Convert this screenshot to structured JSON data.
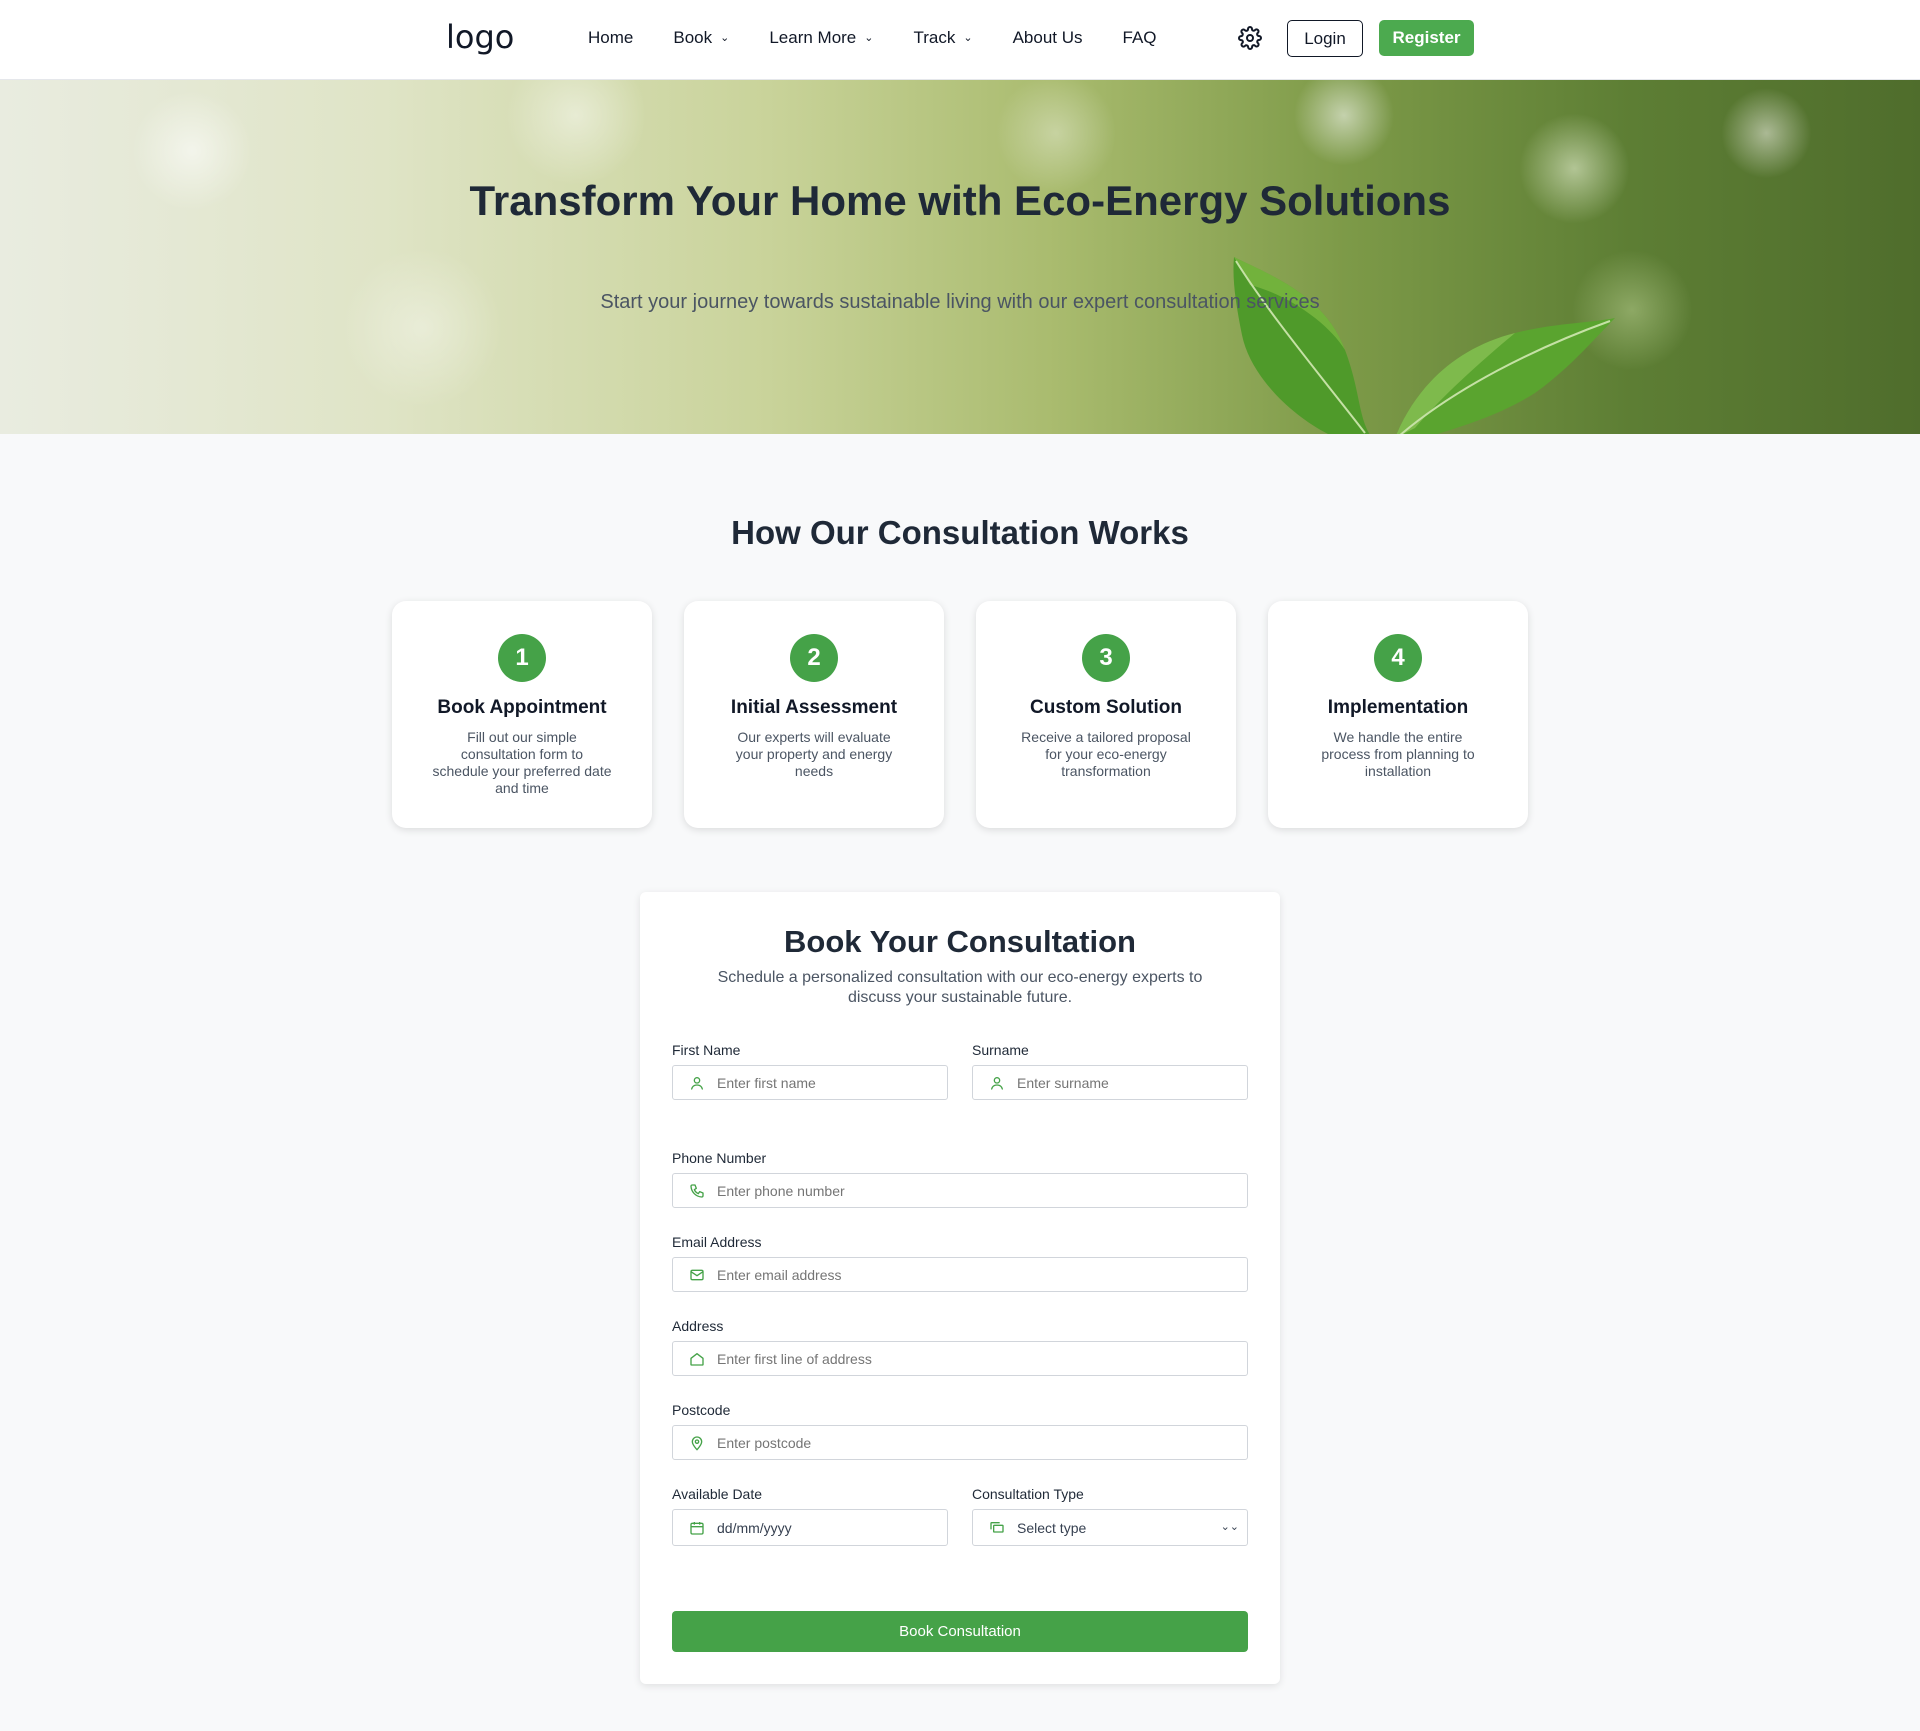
{
  "nav": {
    "logo": "logo",
    "links": [
      {
        "label": "Home",
        "dropdown": false
      },
      {
        "label": "Book",
        "dropdown": true
      },
      {
        "label": "Learn More",
        "dropdown": true
      },
      {
        "label": "Track",
        "dropdown": true
      },
      {
        "label": "About Us",
        "dropdown": false
      },
      {
        "label": "FAQ",
        "dropdown": false
      }
    ],
    "settings_icon": "gear-icon",
    "login_label": "Login",
    "register_label": "Register"
  },
  "hero": {
    "title": "Transform Your Home with Eco-Energy Solutions",
    "subtitle": "Start your journey towards sustainable living with our expert consultation services"
  },
  "how": {
    "title": "How Our Consultation Works",
    "steps": [
      {
        "number": "1",
        "title": "Book Appointment",
        "description": "Fill out our simple consultation form to schedule your preferred date and time"
      },
      {
        "number": "2",
        "title": "Initial Assessment",
        "description": "Our experts will evaluate your property and energy needs"
      },
      {
        "number": "3",
        "title": "Custom Solution",
        "description": "Receive a tailored proposal for your eco-energy transformation"
      },
      {
        "number": "4",
        "title": "Implementation",
        "description": "We handle the entire process from planning to installation"
      }
    ]
  },
  "form": {
    "title": "Book Your Consultation",
    "subtitle": "Schedule a personalized consultation with our eco-energy experts to discuss your sustainable future.",
    "first_name": {
      "label": "First Name",
      "placeholder": "Enter first name",
      "icon": "user-icon"
    },
    "surname": {
      "label": "Surname",
      "placeholder": "Enter surname",
      "icon": "user-icon"
    },
    "phone": {
      "label": "Phone Number",
      "placeholder": "Enter phone number",
      "icon": "phone-icon"
    },
    "email": {
      "label": "Email Address",
      "placeholder": "Enter email address",
      "icon": "mail-icon"
    },
    "address": {
      "label": "Address",
      "placeholder": "Enter first line of address",
      "icon": "home-icon"
    },
    "postcode": {
      "label": "Postcode",
      "placeholder": "Enter postcode",
      "icon": "map-pin-icon"
    },
    "date": {
      "label": "Available Date",
      "placeholder": "dd/mm/yyyy",
      "icon": "calendar-icon"
    },
    "consultation_type": {
      "label": "Consultation Type",
      "selected": "Select type",
      "icon": "chat-icon"
    },
    "submit_label": "Book Consultation"
  },
  "colors": {
    "accent": "#4caa4f",
    "step_circle": "#45a248",
    "text_dark": "#1f2937",
    "text_muted": "#4b5563"
  }
}
